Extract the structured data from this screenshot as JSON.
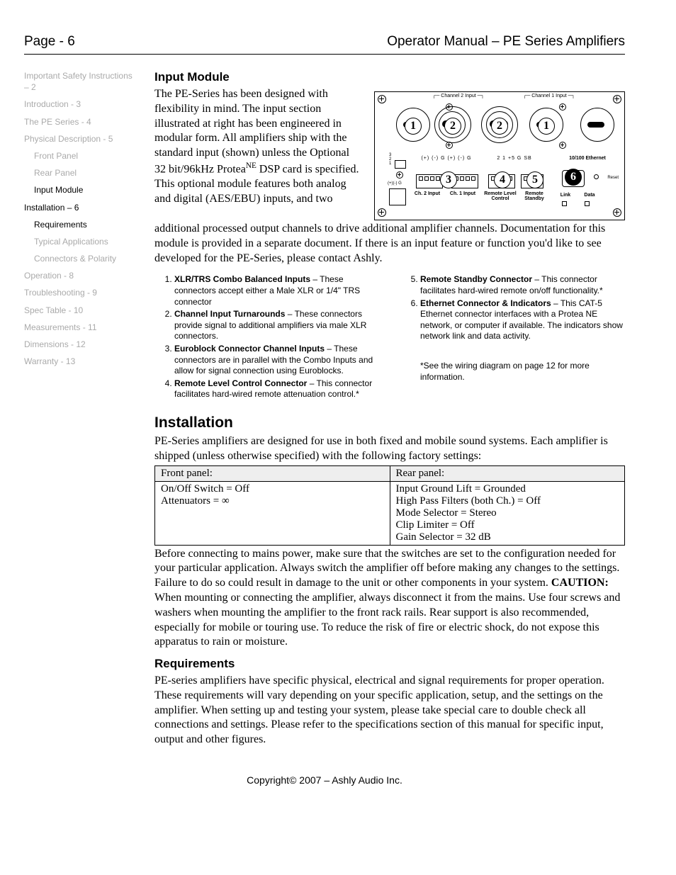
{
  "header": {
    "page_label": "Page - 6",
    "doc_title": "Operator Manual – PE Series Amplifiers"
  },
  "sidebar": {
    "items": [
      {
        "label": "Important Safety Instructions – 2",
        "current": false
      },
      {
        "label": "Introduction - 3",
        "current": false
      },
      {
        "label": "The PE Series - 4",
        "current": false
      },
      {
        "label": "Physical Description - 5",
        "current": false,
        "subs": [
          {
            "label": "Front Panel",
            "current": false
          },
          {
            "label": "Rear Panel",
            "current": false
          },
          {
            "label": "Input Module",
            "current": true
          }
        ]
      },
      {
        "label": "Installation – 6",
        "current": true,
        "subs": [
          {
            "label": "Requirements",
            "current": true
          },
          {
            "label": "Typical Applications",
            "current": false
          },
          {
            "label": "Connectors & Polarity",
            "current": false
          }
        ]
      },
      {
        "label": "Operation - 8",
        "current": false
      },
      {
        "label": "Troubleshooting - 9",
        "current": false
      },
      {
        "label": "Spec Table - 10",
        "current": false
      },
      {
        "label": "Measurements - 11",
        "current": false
      },
      {
        "label": "Dimensions - 12",
        "current": false
      },
      {
        "label": "Warranty - 13",
        "current": false
      }
    ]
  },
  "input_module": {
    "heading": "Input Module",
    "intro_part1": "The PE-Series has been designed with flexibility in mind.  The input section illustrated at right has been engineered in modular form.  All amplifiers ship with the standard input (shown) unless the Optional 32 bit/96kHz Protea",
    "intro_sup": "NE",
    "intro_part2": " DSP card is specified. This optional module features both analog and digital (AES/EBU) inputs, and two",
    "intro_cont": "additional processed output channels to drive additional amplifier channels. Documentation for this module is provided in a separate document.  If there is an input feature or function you'd like to see developed for the PE-Series, please contact Ashly."
  },
  "diagram": {
    "ch2_label": "Channel 2 Input",
    "ch1_label": "Channel 1 Input",
    "row_labels_left": "(+) (-)  G  (+) (-)  G",
    "row_labels_mid": "2   1  +5  G   SB",
    "eth_label": "10/100 Ethernet",
    "ch2_input": "Ch. 2 Input",
    "ch1_input": "Ch. 1 Input",
    "remote_level": "Remote Level Control",
    "remote_standby": "Remote Standby",
    "link": "Link",
    "data": "Data",
    "reset": "Reset"
  },
  "features": {
    "left": [
      {
        "title": "XLR/TRS Combo Balanced Inputs",
        "body": " – These connectors accept either a Male XLR or 1/4\" TRS connector"
      },
      {
        "title": "Channel Input Turnarounds",
        "body": " – These connectors provide signal to additional amplifiers via male XLR connectors."
      },
      {
        "title": "Euroblock Connector Channel Inputs",
        "body": " – These connectors are in parallel with the Combo Inputs and allow for signal connection using Euroblocks."
      },
      {
        "title": "Remote Level Control Connector",
        "body": " – This connector facilitates hard-wired remote attenuation control.*"
      }
    ],
    "right": [
      {
        "title": "Remote Standby Connector",
        "body": " – This connector facilitates hard-wired remote on/off functionality.*"
      },
      {
        "title": "Ethernet Connector & Indicators",
        "body": " – This CAT-5 Ethernet connector interfaces with a Protea NE network, or computer if available.  The indicators show network link and data activity."
      }
    ],
    "note": "*See the wiring diagram on page 12 for more information."
  },
  "installation": {
    "heading": "Installation",
    "intro": "PE-Series amplifiers are designed for use in both fixed and mobile sound systems.  Each amplifier is shipped (unless otherwise specified) with the following factory settings:",
    "table": {
      "front_hdr": "Front panel:",
      "rear_hdr": "Rear panel:",
      "front_lines": [
        "On/Off Switch = Off",
        "Attenuators = ∞"
      ],
      "rear_lines": [
        "Input Ground Lift = Grounded",
        "High Pass Filters (both Ch.) = Off",
        "Mode Selector = Stereo",
        "Clip Limiter = Off",
        "Gain Selector = 32 dB"
      ]
    },
    "after_table_1": "Before connecting to mains power, make sure that the switches are set to the configuration needed for your particular application. Always switch the amplifier off before making any changes to the settings.  Failure to do so could result in damage to the unit or other components in your system.  ",
    "caution_label": "CAUTION:",
    "after_table_2": " When mounting or connecting the amplifier, always disconnect it from the mains.  Use four screws and washers when mounting the amplifier to the front rack rails.  Rear support is also recommended, especially for mobile or touring use. To reduce the risk of fire or electric shock, do not expose this apparatus to rain or moisture.",
    "req_heading": "Requirements",
    "req_body": "PE-series amplifiers have specific physical, electrical and signal requirements for proper operation.  These requirements will vary depending on your specific application, setup, and the settings on the amplifier.  When setting up and testing your system, please take special care to double check all connections and settings.  Please refer to the specifications section of this manual for specific input, output and other figures."
  },
  "footer": "Copyright© 2007 – Ashly Audio Inc."
}
